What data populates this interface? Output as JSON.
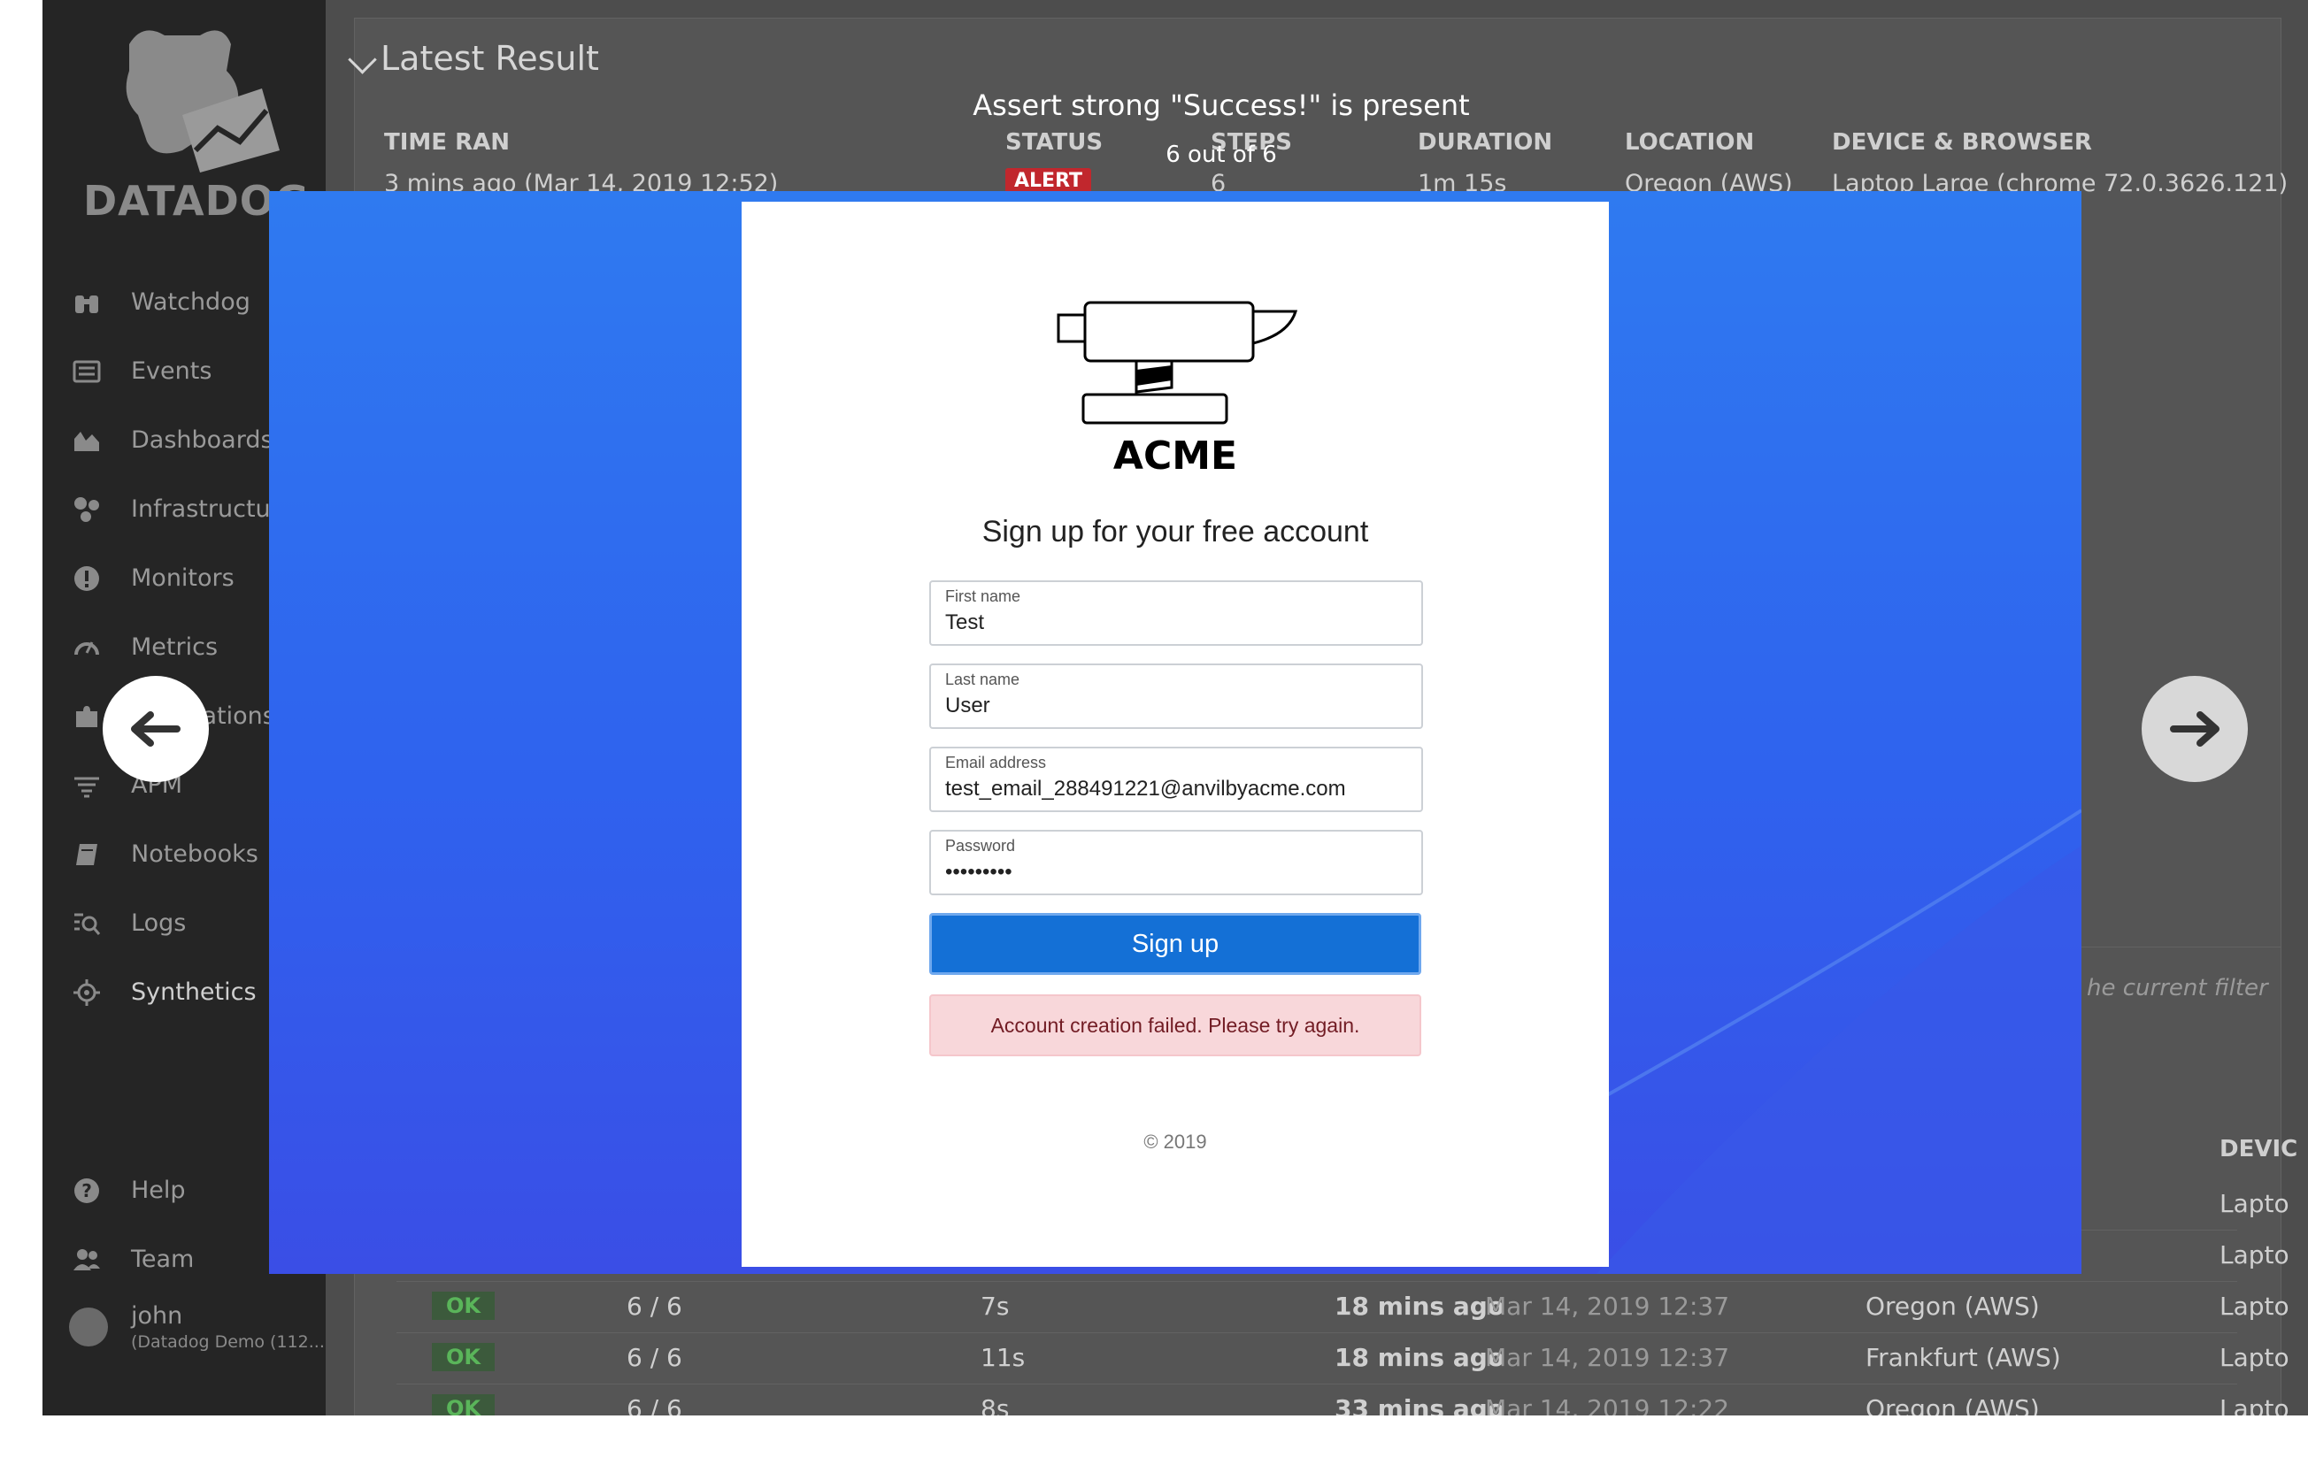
{
  "sidebar": {
    "brand": "DATADOG",
    "items": [
      {
        "label": "Watchdog",
        "icon": "binoculars-icon"
      },
      {
        "label": "Events",
        "icon": "list-icon"
      },
      {
        "label": "Dashboards",
        "icon": "area-chart-icon"
      },
      {
        "label": "Infrastructure",
        "icon": "hexagons-icon"
      },
      {
        "label": "Monitors",
        "icon": "alert-circle-icon"
      },
      {
        "label": "Metrics",
        "icon": "gauge-icon"
      },
      {
        "label": "Integrations",
        "icon": "puzzle-icon"
      },
      {
        "label": "APM",
        "icon": "filter-lines-icon"
      },
      {
        "label": "Notebooks",
        "icon": "notebook-icon"
      },
      {
        "label": "Logs",
        "icon": "logs-search-icon"
      },
      {
        "label": "Synthetics",
        "icon": "synthetics-icon"
      }
    ],
    "help": "Help",
    "team": "Team",
    "user_name": "john",
    "user_org": "(Datadog Demo (112..."
  },
  "latest_result": {
    "title": "Latest Result",
    "headers": {
      "time_ran": "TIME RAN",
      "status": "STATUS",
      "steps": "STEPS",
      "duration": "DURATION",
      "location": "LOCATION",
      "device": "DEVICE & BROWSER"
    },
    "values": {
      "time_ran": "3 mins ago (Mar 14, 2019 12:52)",
      "status": "ALERT",
      "steps": "6",
      "duration": "1m 15s",
      "location": "Oregon (AWS)",
      "device": "Laptop Large (chrome 72.0.3626.121)"
    }
  },
  "history": {
    "filter_note": "he current filter",
    "device_header": "DEVIC",
    "rows": [
      {
        "status": "OK",
        "steps": "6 / 6",
        "duration": "7s",
        "ago": "18 mins ago",
        "date": "Mar 14, 2019 12:37",
        "location": "Oregon (AWS)",
        "device": "Lapto"
      },
      {
        "status": "OK",
        "steps": "6 / 6",
        "duration": "11s",
        "ago": "18 mins ago",
        "date": "Mar 14, 2019 12:37",
        "location": "Frankfurt (AWS)",
        "device": "Lapto"
      },
      {
        "status": "OK",
        "steps": "6 / 6",
        "duration": "8s",
        "ago": "33 mins ago",
        "date": "Mar 14, 2019 12:22",
        "location": "Oregon (AWS)",
        "device": "Lapto"
      }
    ],
    "device_above": [
      "Lapto",
      "Lapto"
    ]
  },
  "modal": {
    "title": "Assert strong \"Success!\" is present",
    "counter": "6 out of 6",
    "prev_icon": "arrow-left-icon",
    "next_icon": "arrow-right-icon"
  },
  "acme": {
    "brand": "ACME",
    "headline": "Sign up for your free account",
    "fields": [
      {
        "label": "First name",
        "value": "Test"
      },
      {
        "label": "Last name",
        "value": "User"
      },
      {
        "label": "Email address",
        "value": "test_email_288491221@anvilbyacme.com"
      },
      {
        "label": "Password",
        "value": "•••••••••"
      }
    ],
    "signup_label": "Sign up",
    "error": "Account creation failed. Please try again.",
    "copyright": "© 2019"
  },
  "colors": {
    "sidebar_bg": "#252525",
    "modal_blue": "#2f6cf0",
    "button_blue": "#1470d6",
    "error_bg": "#f8d7da",
    "error_text": "#721c24",
    "alert_red": "#c1272d",
    "ok_green": "#5ab55a"
  }
}
